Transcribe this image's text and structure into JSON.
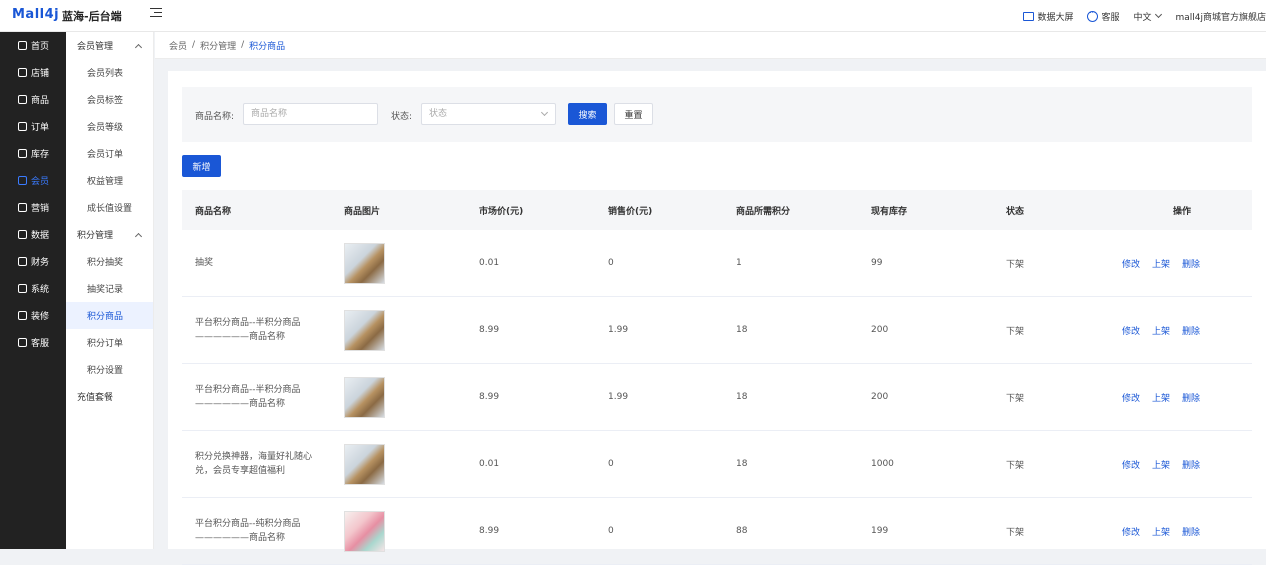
{
  "topbar": {
    "logo": "Mall4j",
    "brand": "蓝海-后台端",
    "data_screen": "数据大屏",
    "service": "客服",
    "language": "中文",
    "shop": "mall4j商城官方旗舰店"
  },
  "side1": [
    {
      "label": "首页",
      "icon": "home-icon"
    },
    {
      "label": "店铺",
      "icon": "shop-icon"
    },
    {
      "label": "商品",
      "icon": "product-icon"
    },
    {
      "label": "订单",
      "icon": "order-icon"
    },
    {
      "label": "库存",
      "icon": "stock-icon"
    },
    {
      "label": "会员",
      "icon": "member-icon"
    },
    {
      "label": "营销",
      "icon": "marketing-icon"
    },
    {
      "label": "数据",
      "icon": "data-icon"
    },
    {
      "label": "财务",
      "icon": "finance-icon"
    },
    {
      "label": "系统",
      "icon": "system-icon"
    },
    {
      "label": "装修",
      "icon": "decorate-icon"
    },
    {
      "label": "客服",
      "icon": "service-icon"
    }
  ],
  "side2": {
    "group1": "会员管理",
    "group1_items": [
      "会员列表",
      "会员标签",
      "会员等级",
      "会员订单",
      "权益管理",
      "成长值设置"
    ],
    "group2": "积分管理",
    "group2_items": [
      "积分抽奖",
      "抽奖记录",
      "积分商品",
      "积分订单",
      "积分设置"
    ],
    "extra": "充值套餐"
  },
  "breadcrumb": [
    "会员",
    "积分管理",
    "积分商品"
  ],
  "filter": {
    "name_label": "商品名称:",
    "name_placeholder": "商品名称",
    "status_label": "状态:",
    "status_placeholder": "状态",
    "search": "搜索",
    "reset": "重置"
  },
  "add_button": "新增",
  "table": {
    "headers": [
      "商品名称",
      "商品图片",
      "市场价(元)",
      "销售价(元)",
      "商品所需积分",
      "现有库存",
      "状态",
      "操作"
    ],
    "rows": [
      {
        "name": "抽奖",
        "market": "0.01",
        "sale": "0",
        "points": "1",
        "stock": "99",
        "status": "下架",
        "img": "bag"
      },
      {
        "name": "平台积分商品--半积分商品——————商品名称",
        "market": "8.99",
        "sale": "1.99",
        "points": "18",
        "stock": "200",
        "status": "下架",
        "img": "bag"
      },
      {
        "name": "平台积分商品--半积分商品——————商品名称",
        "market": "8.99",
        "sale": "1.99",
        "points": "18",
        "stock": "200",
        "status": "下架",
        "img": "bag"
      },
      {
        "name": "积分兑换神器，海量好礼随心兑，会员专享超值福利",
        "market": "0.01",
        "sale": "0",
        "points": "18",
        "stock": "1000",
        "status": "下架",
        "img": "bag"
      },
      {
        "name": "平台积分商品--纯积分商品——————商品名称",
        "market": "8.99",
        "sale": "0",
        "points": "88",
        "stock": "199",
        "status": "下架",
        "img": "pink"
      }
    ],
    "ops": [
      "修改",
      "上架",
      "删除"
    ]
  },
  "colors": {
    "accent": "#1a57d6",
    "sidebar": "#222222"
  }
}
